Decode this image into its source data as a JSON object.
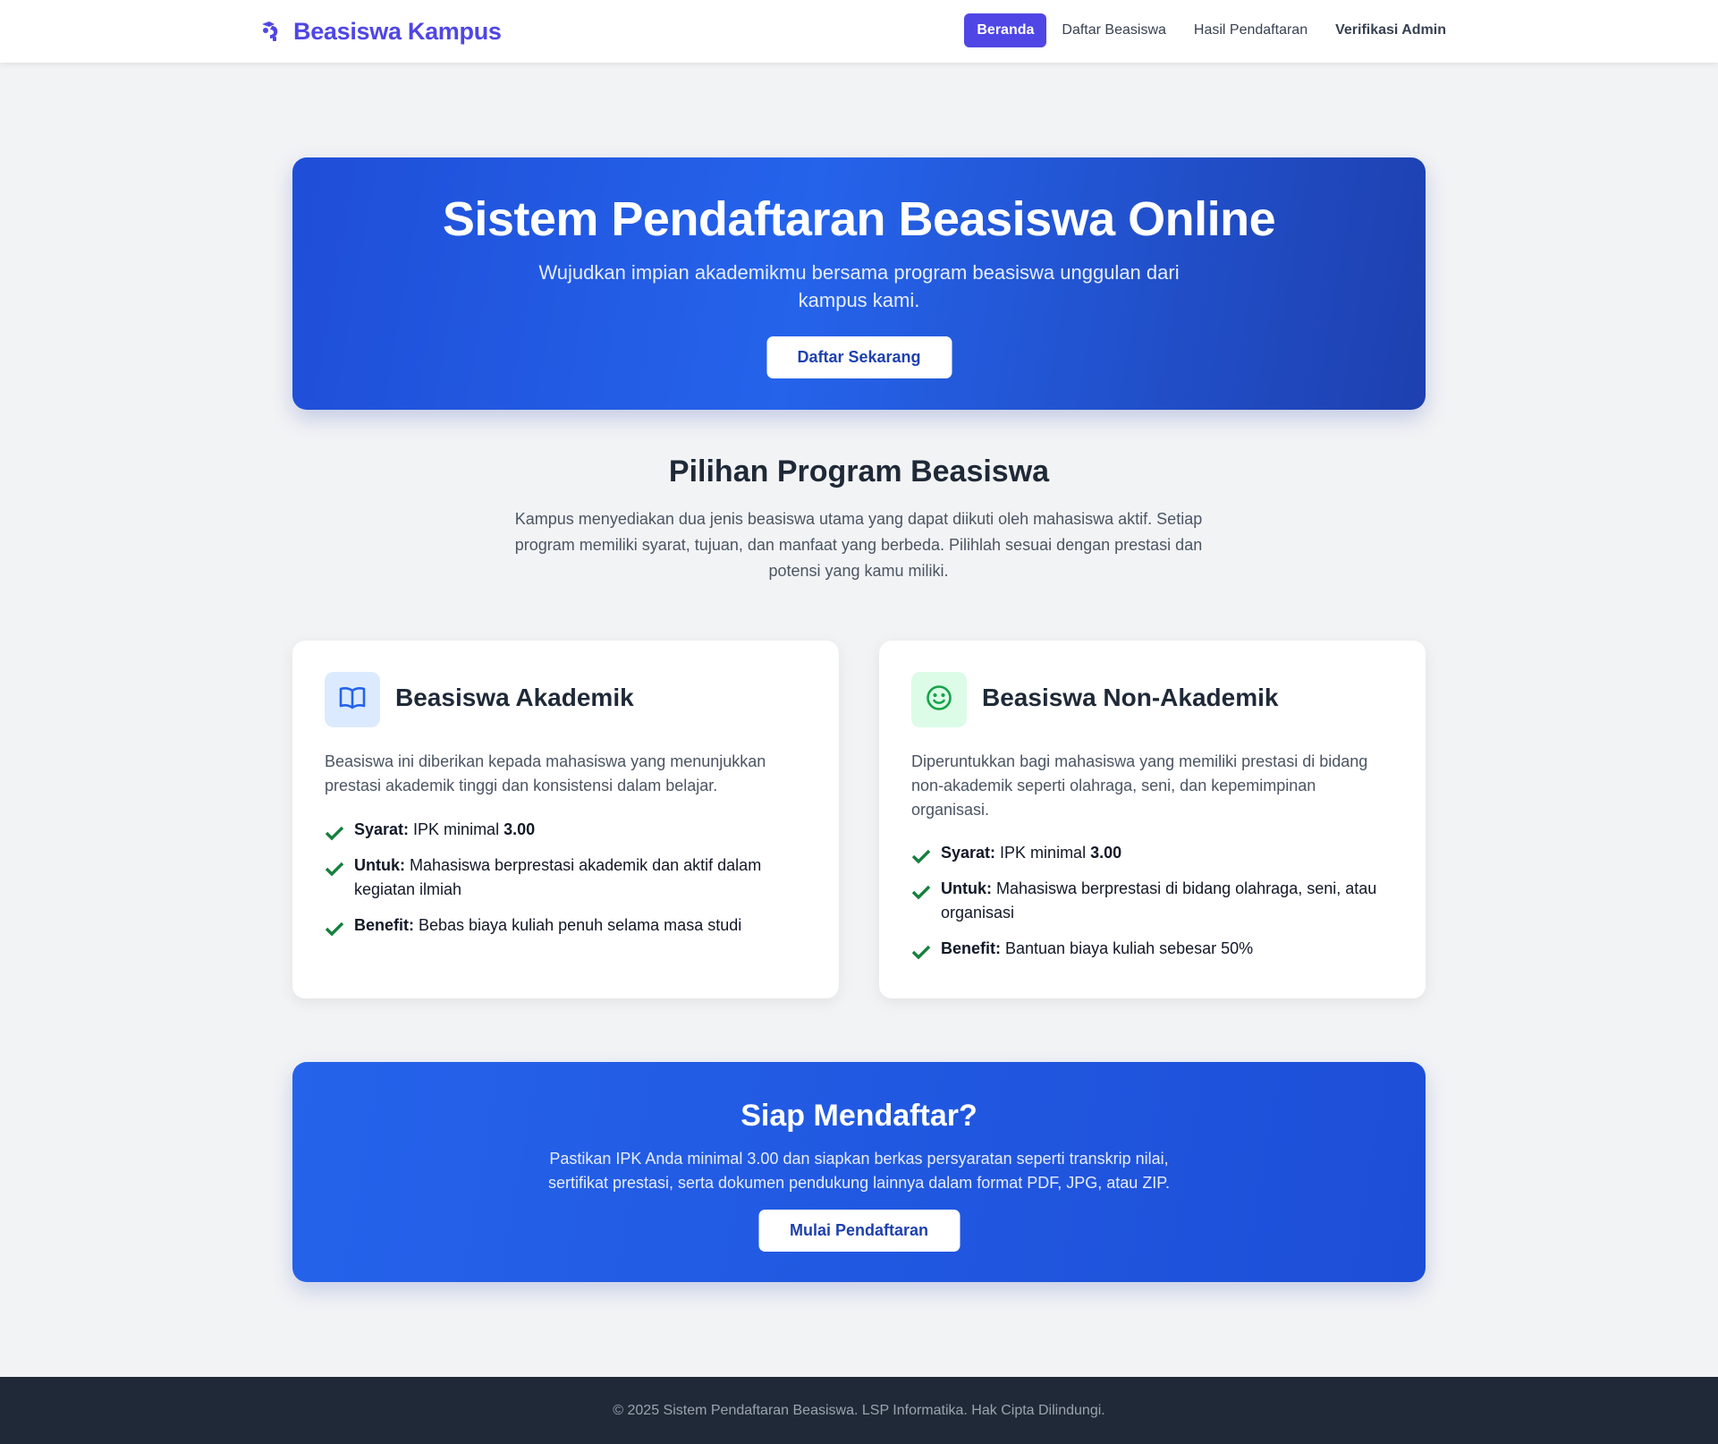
{
  "brand": {
    "name": "Beasiswa Kampus",
    "icon": "graduation-hand-icon",
    "color": "#4f46e5"
  },
  "nav": {
    "items": [
      {
        "label": "Beranda",
        "active": true
      },
      {
        "label": "Daftar Beasiswa",
        "active": false
      },
      {
        "label": "Hasil Pendaftaran",
        "active": false
      },
      {
        "label": "Verifikasi Admin",
        "active": false
      }
    ]
  },
  "hero": {
    "title": "Sistem Pendaftaran Beasiswa Online",
    "subtitle": "Wujudkan impian akademikmu bersama program beasiswa unggulan dari kampus kami.",
    "button": "Daftar Sekarang"
  },
  "programs": {
    "title": "Pilihan Program Beasiswa",
    "description": "Kampus menyediakan dua jenis beasiswa utama yang dapat diikuti oleh mahasiswa aktif. Setiap program memiliki syarat, tujuan, dan manfaat yang berbeda. Pilihlah sesuai dengan prestasi dan potensi yang kamu miliki.",
    "cards": [
      {
        "icon": "book-open-icon",
        "title": "Beasiswa Akademik",
        "description": "Beasiswa ini diberikan kepada mahasiswa yang menunjukkan prestasi akademik tinggi dan konsistensi dalam belajar.",
        "items": [
          {
            "label": "Syarat:",
            "text": "IPK minimal",
            "value": "3.00"
          },
          {
            "label": "Untuk:",
            "text": "Mahasiswa berprestasi akademik dan aktif dalam kegiatan ilmiah",
            "value": ""
          },
          {
            "label": "Benefit:",
            "text": "Bebas biaya kuliah penuh selama masa studi",
            "value": ""
          }
        ]
      },
      {
        "icon": "smile-face-icon",
        "title": "Beasiswa Non-Akademik",
        "description": "Diperuntukkan bagi mahasiswa yang memiliki prestasi di bidang non-akademik seperti olahraga, seni, dan kepemimpinan organisasi.",
        "items": [
          {
            "label": "Syarat:",
            "text": "IPK minimal",
            "value": "3.00"
          },
          {
            "label": "Untuk:",
            "text": "Mahasiswa berprestasi di bidang olahraga, seni, atau organisasi",
            "value": ""
          },
          {
            "label": "Benefit:",
            "text": "Bantuan biaya kuliah sebesar 50%",
            "value": ""
          }
        ]
      }
    ]
  },
  "cta": {
    "title": "Siap Mendaftar?",
    "description": "Pastikan IPK Anda minimal 3.00 dan siapkan berkas persyaratan seperti transkrip nilai, sertifikat prestasi, serta dokumen pendukung lainnya dalam format PDF, JPG, atau ZIP.",
    "button": "Mulai Pendaftaran"
  },
  "footer": {
    "text": "© 2025 Sistem Pendaftaran Beasiswa. LSP Informatika. Hak Cipta Dilindungi."
  },
  "colors": {
    "primary": "#4f46e5",
    "hero_blue": "#2563eb",
    "check_green": "#15803d",
    "footer_bg": "#1f2937"
  }
}
